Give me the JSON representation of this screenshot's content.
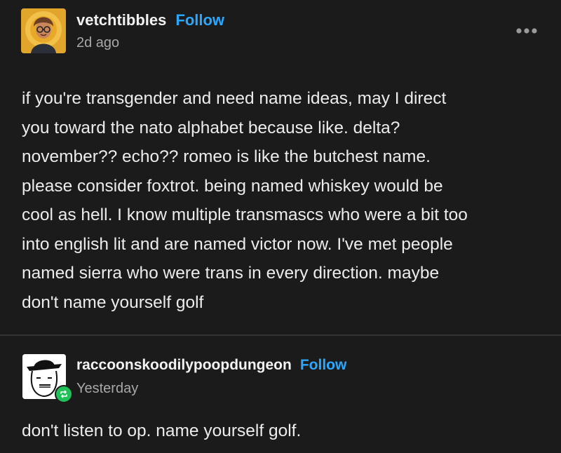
{
  "post": {
    "username": "vetchtibbles",
    "follow_label": "Follow",
    "timestamp": "2d ago",
    "more_icon": "ellipsis-icon",
    "body_lines": [
      "if you're transgender and need name ideas, may I direct",
      "you toward the nato alphabet because like. delta?",
      "november?? echo?? romeo is like the butchest name.",
      "please consider foxtrot. being named whiskey would be",
      "cool as hell. I know multiple transmascs who were a bit too",
      "into english lit and are named victor now. I've met people",
      "named sierra who were trans in every direction. maybe",
      "don't name yourself golf"
    ]
  },
  "reblog": {
    "username": "raccoonskoodilypoopdungeon",
    "follow_label": "Follow",
    "timestamp": "Yesterday",
    "badge_icon": "reblog-icon",
    "body": "don't listen to op. name yourself golf."
  },
  "colors": {
    "background": "#1b1b1b",
    "follow": "#2aa8ff",
    "reblog_badge": "#21c15a",
    "secondary_text": "#a8a8a8"
  }
}
